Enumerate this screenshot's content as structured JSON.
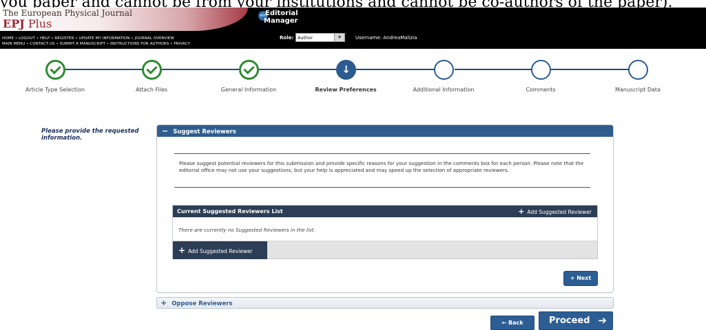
{
  "top_cut_text": "you paper and cannot be from your institutions and cannot be co-authors of the paper).",
  "brand": {
    "title": "The European Physical Journal",
    "name_prefix": "EPJ",
    "name_suffix": "Plus"
  },
  "nav": {
    "line1": "HOME • LOGOUT • HELP • REGISTER • UPDATE MY INFORMATION • JOURNAL OVERVIEW",
    "line2": "MAIN MENU • CONTACT US • SUBMIT A MANUSCRIPT • INSTRUCTIONS FOR AUTHORS • PRIVACY"
  },
  "editorial_manager": {
    "line1": "Editorial",
    "line2": "Manager"
  },
  "role": {
    "label": "Role:",
    "value": "Author"
  },
  "username": "Username: AndreaMalizia",
  "steps": [
    {
      "label": "Article Type Selection",
      "status": "done"
    },
    {
      "label": "Attach Files",
      "status": "done"
    },
    {
      "label": "General Information",
      "status": "done"
    },
    {
      "label": "Review Preferences",
      "status": "current"
    },
    {
      "label": "Additional Information",
      "status": "todo"
    },
    {
      "label": "Comments",
      "status": "todo"
    },
    {
      "label": "Manuscript Data",
      "status": "todo"
    }
  ],
  "left_note": "Please provide the requested information.",
  "suggest_panel": {
    "header": "Suggest Reviewers",
    "instructions": "Please suggest potential reviewers for this submission and provide specific reasons for your suggestion in the comments box for each person. Please note that the editorial office may not use your suggestions, but your help is appreciated and may speed up the selection of appropriate reviewers.",
    "list_title": "Current Suggested Reviewers List",
    "add_reviewer_label": "Add Suggested Reviewer",
    "empty_text": "There are currently no Suggested Reviewers in the list.",
    "next_label": "Next"
  },
  "oppose_panel": {
    "header": "Oppose Reviewers"
  },
  "footer": {
    "back_label": "Back",
    "proceed_label": "Proceed"
  },
  "colors": {
    "header_bg": "#000000",
    "panel_blue": "#2f5d8e",
    "list_head": "#2c3e55",
    "step_done": "#2e8b30",
    "brand_red": "#9c2433"
  }
}
